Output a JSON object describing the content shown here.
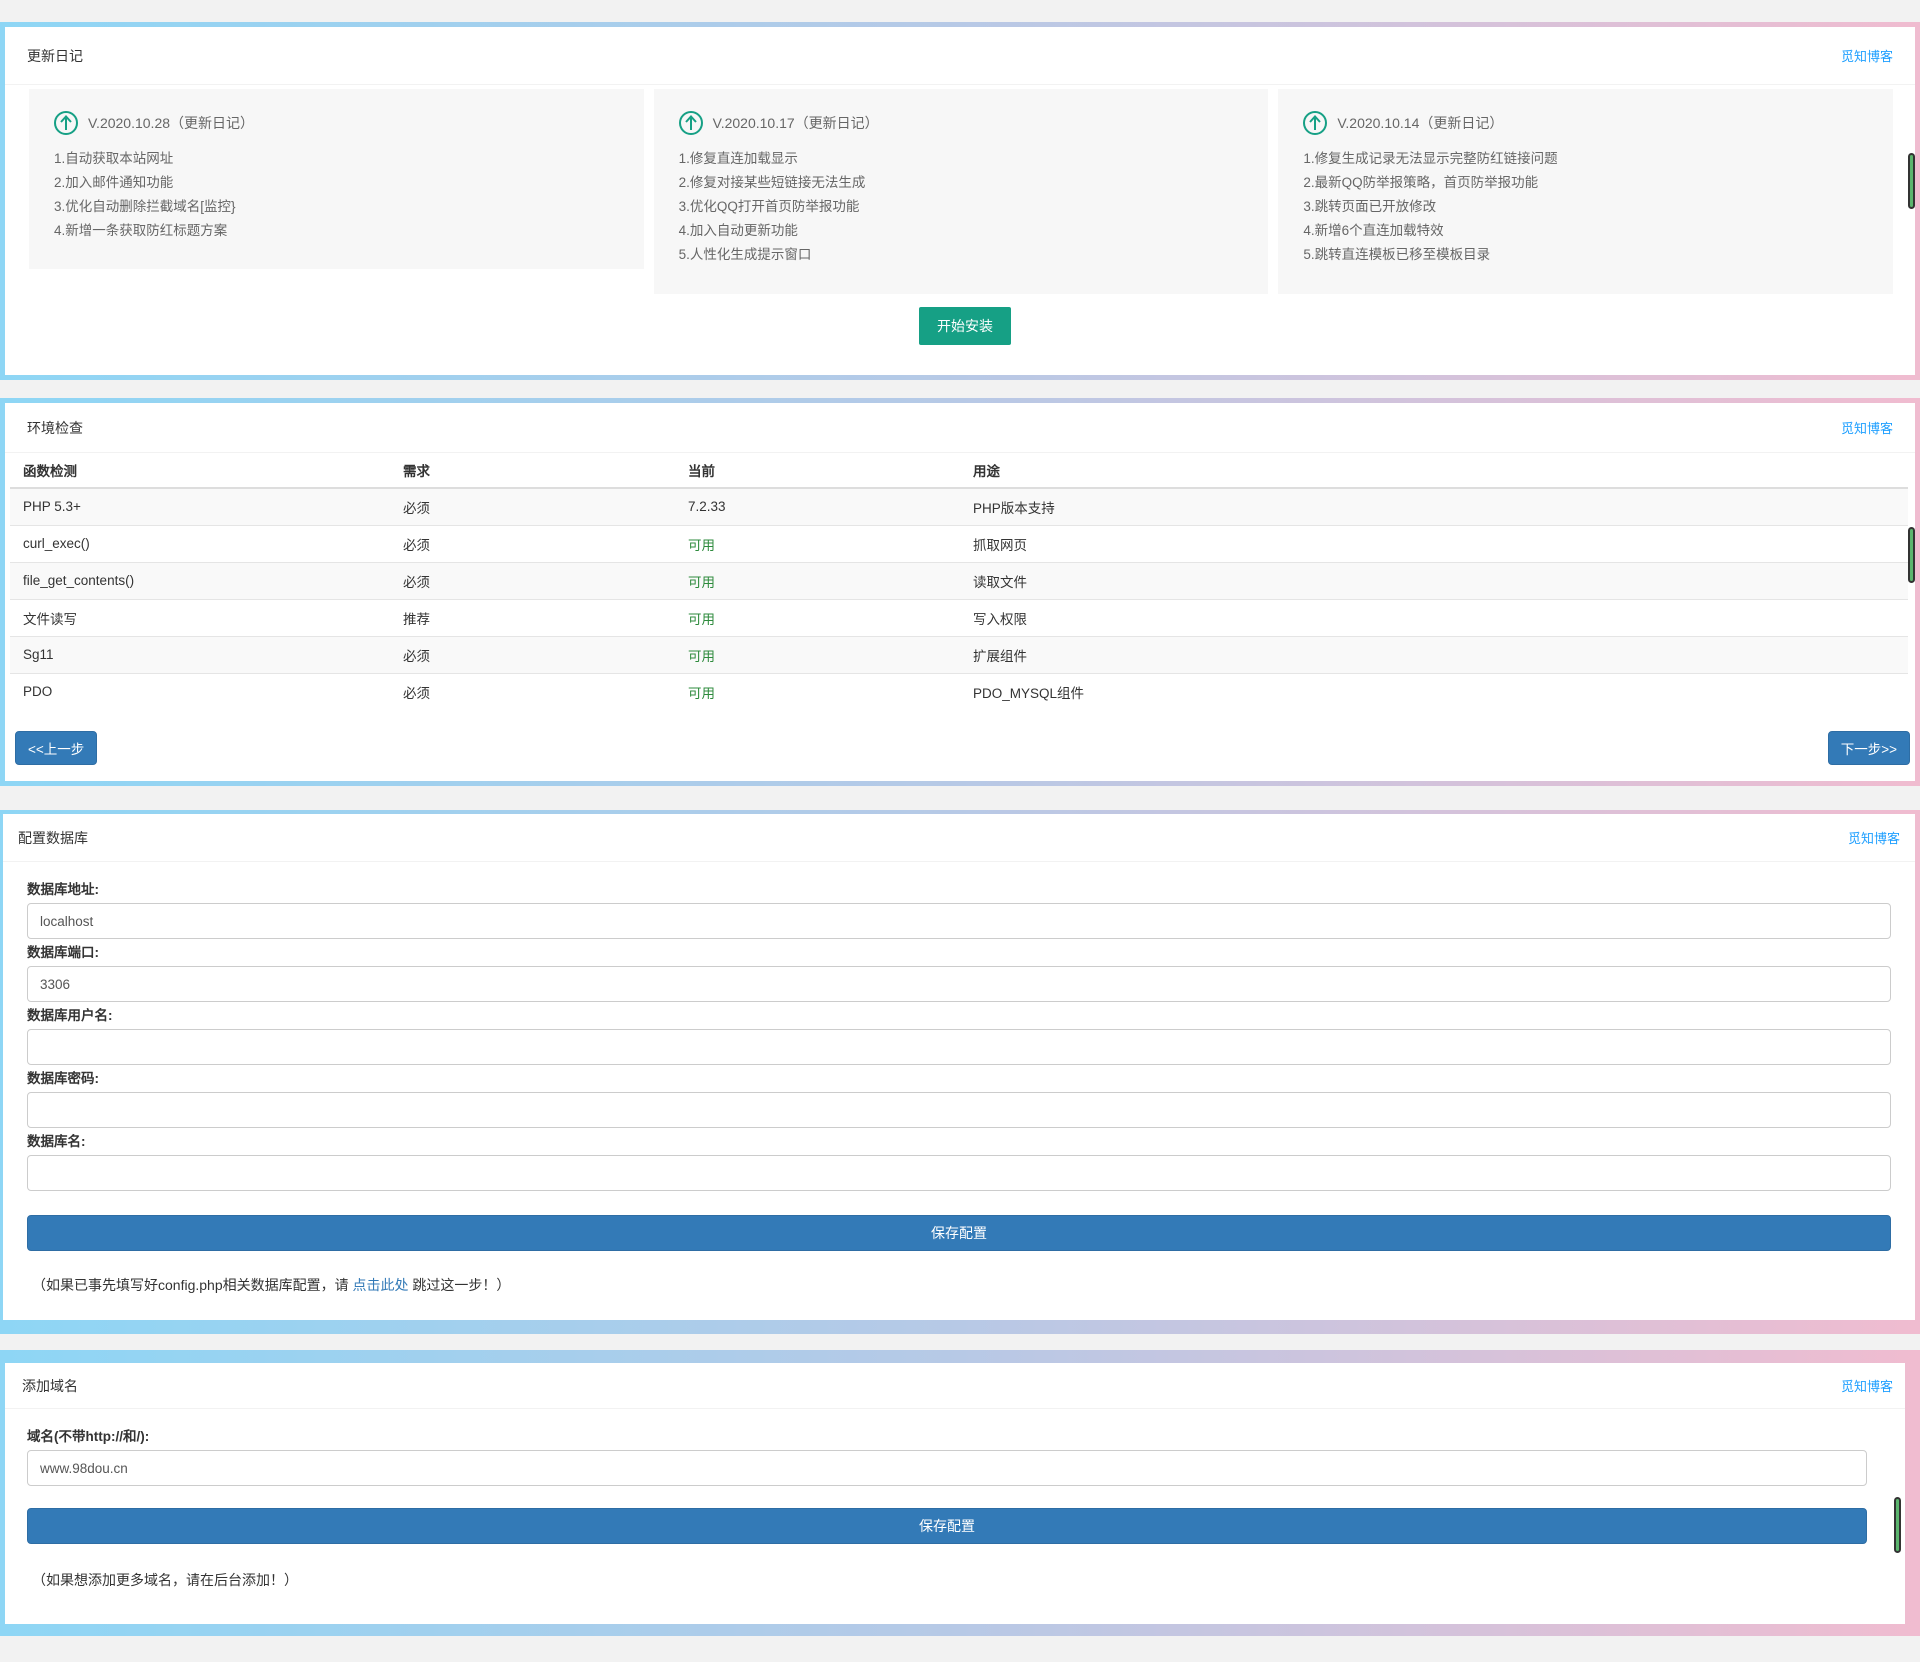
{
  "changelog": {
    "title": "更新日记",
    "blog_link": "觅知博客",
    "cards": [
      {
        "version": "V.2020.10.28（更新日记）",
        "items": [
          "1.自动获取本站网址",
          "2.加入邮件通知功能",
          "3.优化自动删除拦截域名[监控}",
          "4.新增一条获取防红标题方案"
        ]
      },
      {
        "version": "V.2020.10.17（更新日记）",
        "items": [
          "1.修复直连加载显示",
          "2.修复对接某些短链接无法生成",
          "3.优化QQ打开首页防举报功能",
          "4.加入自动更新功能",
          "5.人性化生成提示窗口"
        ]
      },
      {
        "version": "V.2020.10.14（更新日记）",
        "items": [
          "1.修复生成记录无法显示完整防红链接问题",
          "2.最新QQ防举报策略，首页防举报功能",
          "3.跳转页面已开放修改",
          "4.新增6个直连加载特效",
          "5.跳转直连模板已移至模板目录"
        ]
      }
    ],
    "install_button": "开始安装",
    "icon": "arrow-up-circle-icon"
  },
  "env": {
    "title": "环境检查",
    "blog_link": "觅知博客",
    "headers": [
      "函数检测",
      "需求",
      "当前",
      "用途"
    ],
    "rows": [
      [
        "PHP 5.3+",
        "必须",
        "7.2.33",
        "PHP版本支持"
      ],
      [
        "curl_exec()",
        "必须",
        "可用",
        "抓取网页"
      ],
      [
        "file_get_contents()",
        "必须",
        "可用",
        "读取文件"
      ],
      [
        "文件读写",
        "推荐",
        "可用",
        "写入权限"
      ],
      [
        "Sg11",
        "必须",
        "可用",
        "扩展组件"
      ],
      [
        "PDO",
        "必须",
        "可用",
        "PDO_MYSQL组件"
      ]
    ],
    "prev_button": "<<上一步",
    "next_button": "下一步>>",
    "ok_color": "#2e8b3d"
  },
  "db": {
    "title": "配置数据库",
    "blog_link": "觅知博客",
    "fields": [
      {
        "label": "数据库地址:",
        "value": "localhost"
      },
      {
        "label": "数据库端口:",
        "value": "3306"
      },
      {
        "label": "数据库用户名:",
        "value": ""
      },
      {
        "label": "数据库密码:",
        "value": ""
      },
      {
        "label": "数据库名:",
        "value": ""
      }
    ],
    "save_button": "保存配置",
    "note_prefix": "（如果已事先填写好config.php相关数据库配置，请 ",
    "note_link": "点击此处",
    "note_suffix": " 跳过这一步！）"
  },
  "domain": {
    "title": "添加域名",
    "blog_link": "觅知博客",
    "label": "域名(不带http://和/):",
    "value": "www.98dou.cn",
    "save_button": "保存配置",
    "note": "（如果想添加更多域名，请在后台添加！）"
  },
  "colors": {
    "accent_green": "#16a085",
    "primary_blue": "#337ab7",
    "link_blue": "#1e9fff"
  }
}
